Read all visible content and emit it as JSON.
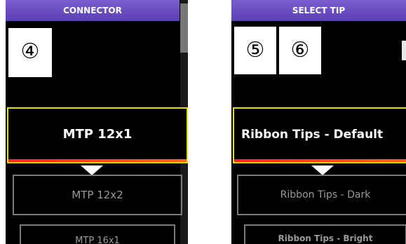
{
  "left_panel": {
    "title": "CONNECTOR",
    "callout": "④",
    "selected_item": "MTP 12x1",
    "items": [
      "MTP 12x2",
      "MTP 16x1"
    ]
  },
  "right_panel": {
    "title": "SELECT TIP",
    "callouts": [
      "⑤",
      "⑥"
    ],
    "selected_item": "Ribbon Tips - Default",
    "items": [
      "Ribbon Tips - Dark",
      "Ribbon Tips - Bright"
    ]
  },
  "colors": {
    "title_bar": "#6a4fc2",
    "selection_border": "#e6e000",
    "selection_underline": "#ff3a00",
    "item_border": "#7a7a7a"
  }
}
